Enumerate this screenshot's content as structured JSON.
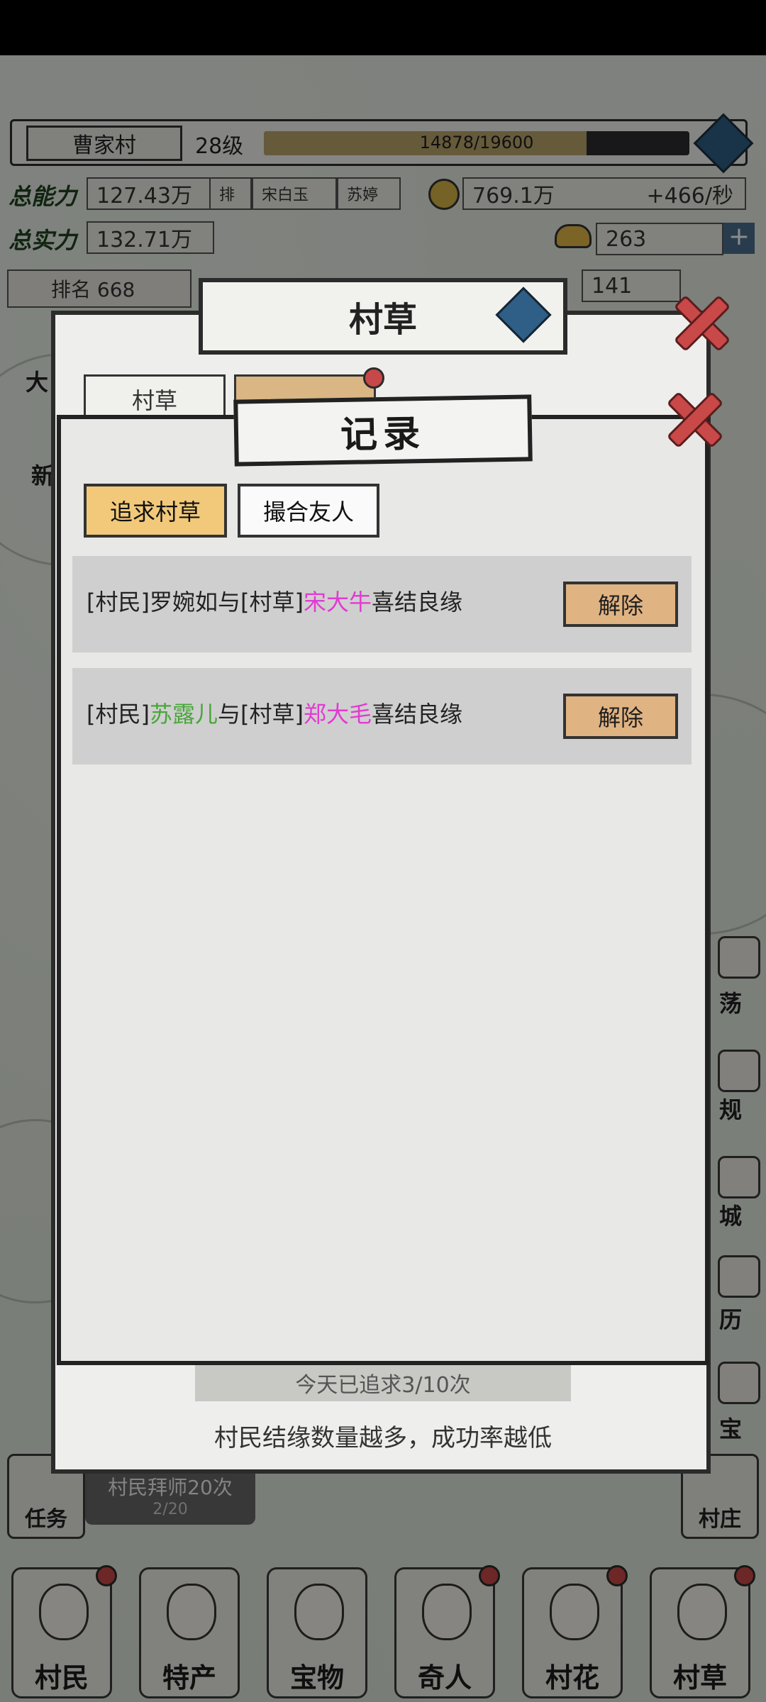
{
  "topbar": {
    "village_name": "曹家村",
    "level": "28级",
    "exp_text": "14878/19600",
    "exp_fraction": 0.759
  },
  "stats": {
    "total_power_label": "总能力",
    "total_power": "127.43万",
    "rank_short": "排",
    "ranked_names": [
      "宋白玉",
      "苏婷"
    ],
    "coins": "769.1万",
    "coin_rate": "+466/秒",
    "total_wealth_label": "总实力",
    "total_wealth": "132.71万",
    "ingots": "263",
    "rank": "排名 668",
    "items_count": "141"
  },
  "back_modal": {
    "title": "村草",
    "tab1": "村草",
    "footer_count": "今天已追求3/10次",
    "footer_hint": "村民结缘数量越多，成功率越低"
  },
  "record_modal": {
    "title": "记录",
    "tabs": [
      "追求村草",
      "撮合友人"
    ],
    "records": [
      {
        "prefix1": "[村民]",
        "name1": "罗婉如",
        "conj": "与",
        "prefix2": "[村草]",
        "name2": "宋大牛",
        "suffix": "喜结良缘",
        "button": "解除"
      },
      {
        "prefix1": "[村民]",
        "name1": "苏露儿",
        "conj": "与",
        "prefix2": "[村草]",
        "name2": "郑大毛",
        "suffix": "喜结良缘",
        "button": "解除"
      }
    ]
  },
  "side": {
    "left_labels": [
      "大",
      "新"
    ],
    "right_labels": [
      "荡",
      "规",
      "城",
      "历",
      "宝"
    ]
  },
  "bottom": {
    "task_label": "任务",
    "village_label": "村庄",
    "apprentice_title": "村民拜师20次",
    "apprentice_progress": "2/20",
    "nav": [
      "村民",
      "特产",
      "宝物",
      "奇人",
      "村花",
      "村草"
    ]
  },
  "colors": {
    "highlight_pink": "#e23bd2",
    "highlight_green": "#49a63a",
    "active_tab": "#f2c97a",
    "dissolve_button": "#e0b382",
    "close_red": "#c94848"
  }
}
